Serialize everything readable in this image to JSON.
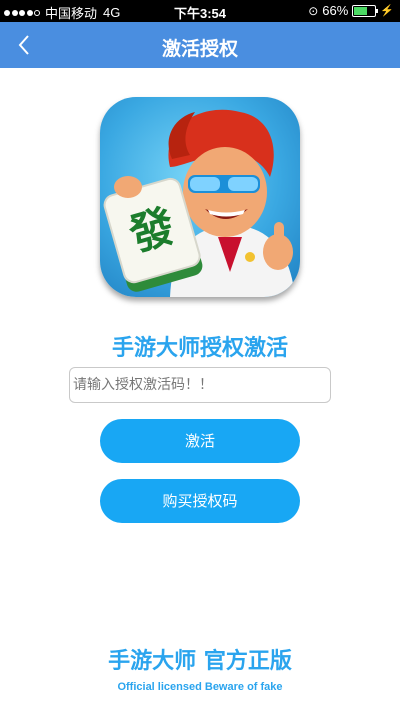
{
  "status_bar": {
    "carrier": "中国移动",
    "network": "4G",
    "time": "下午3:54",
    "battery_percent": "66%",
    "battery_level": 0.66
  },
  "nav": {
    "title": "激活授权",
    "back_icon": "chevron-left-icon"
  },
  "app_icon": {
    "tile_character": "發"
  },
  "main": {
    "heading": "手游大师授权激活",
    "code_input": {
      "placeholder": "请输入授权激活码！！",
      "value": ""
    },
    "activate_label": "激活",
    "buy_label": "购买授权码"
  },
  "footer": {
    "title": "手游大师  官方正版",
    "subtitle": "Official licensed Beware of fake"
  },
  "colors": {
    "nav_bar": "#4a8ee0",
    "button": "#18a7f4",
    "accent_text": "#2aa4ee"
  }
}
